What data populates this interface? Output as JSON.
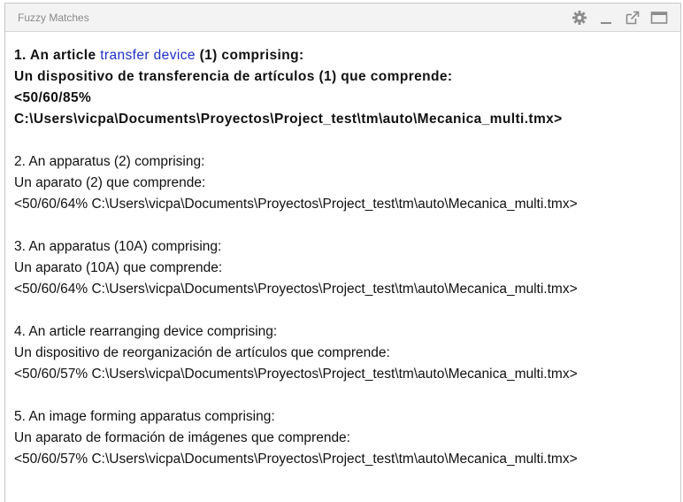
{
  "panel": {
    "title": "Fuzzy Matches",
    "icons": [
      "gear-icon",
      "minimize-icon",
      "popout-icon",
      "maximize-icon"
    ]
  },
  "matches": [
    {
      "source_prefix": "1. An article ",
      "source_highlight": "transfer device",
      "source_suffix": " (1) comprising:",
      "target": "Un dispositivo de transferencia de artículos (1) que comprende:",
      "score_line1": "<50/60/85%",
      "score_line2": "C:\\Users\\vicpa\\Documents\\Proyectos\\Project_test\\tm\\auto\\Mecanica_multi.tmx>",
      "active": true
    },
    {
      "source": "2. An apparatus (2) comprising:",
      "target": "Un aparato (2) que comprende:",
      "info": "<50/60/64% C:\\Users\\vicpa\\Documents\\Proyectos\\Project_test\\tm\\auto\\Mecanica_multi.tmx>"
    },
    {
      "source": "3. An apparatus (10A) comprising:",
      "target": "Un aparato (10A) que comprende:",
      "info": "<50/60/64% C:\\Users\\vicpa\\Documents\\Proyectos\\Project_test\\tm\\auto\\Mecanica_multi.tmx>"
    },
    {
      "source": "4. An article rearranging device comprising:",
      "target": "Un dispositivo de reorganización de artículos que comprende:",
      "info": "<50/60/57% C:\\Users\\vicpa\\Documents\\Proyectos\\Project_test\\tm\\auto\\Mecanica_multi.tmx>"
    },
    {
      "source": "5. An image forming apparatus comprising:",
      "target": "Un aparato de formación de imágenes que comprende:",
      "info": "<50/60/57% C:\\Users\\vicpa\\Documents\\Proyectos\\Project_test\\tm\\auto\\Mecanica_multi.tmx>"
    }
  ],
  "colors": {
    "highlight": "#1f2fc8",
    "title_text": "#8a8a8a",
    "icon": "#8c8c8c"
  }
}
